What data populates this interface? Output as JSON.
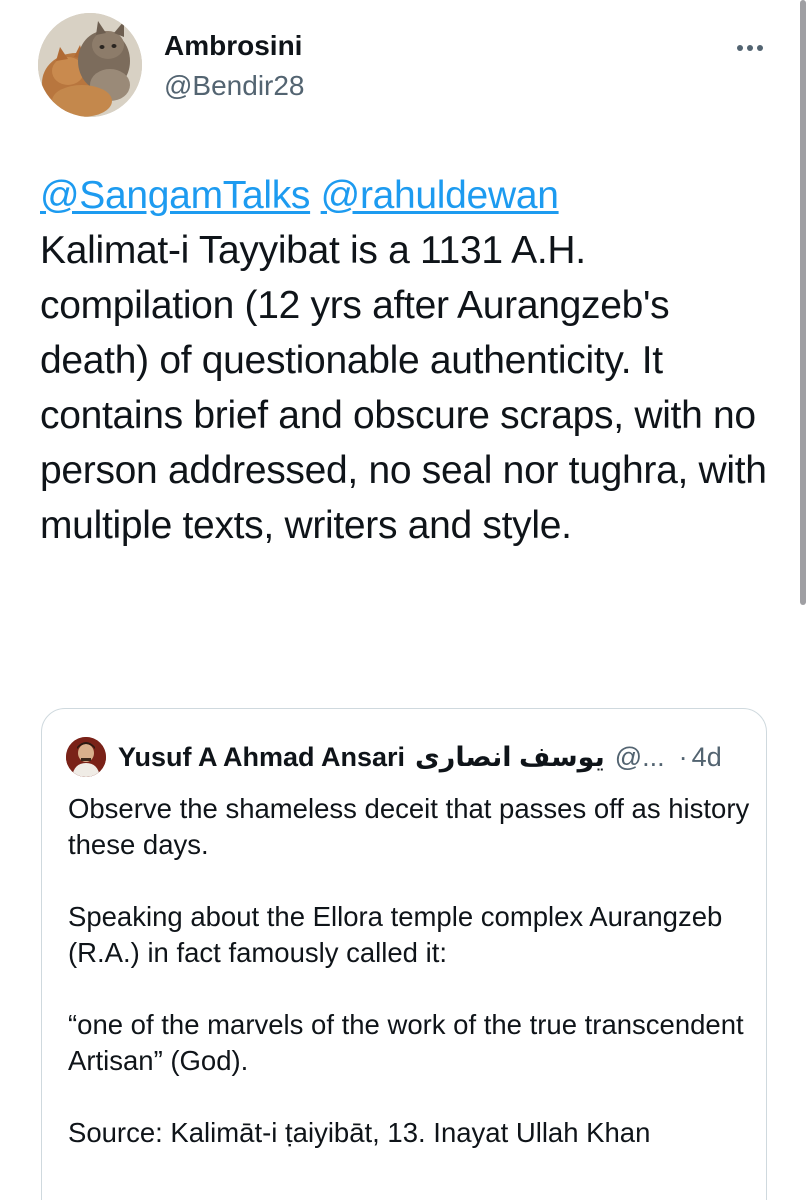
{
  "author": {
    "name": "Ambrosini",
    "handle": "@Bendir28",
    "avatar_icon": "cat-avatar-icon"
  },
  "tweet": {
    "mentions": [
      "@SangamTalks",
      "@rahuldewan"
    ],
    "text": "Kalimat-i Tayyibat is a 1131 A.H. compilation (12 yrs after Aurangzeb's death) of questionable authenticity. It contains brief and obscure scraps, with no person addressed, no seal nor tughra, with multiple texts, writers and style."
  },
  "more_icon": "more-horizontal-icon",
  "quote": {
    "name": "Yusuf A Ahmad Ansari",
    "name_urdu": "یوسف انصاری",
    "handle": "@...",
    "separator": "·",
    "time": "4d",
    "paragraphs": [
      "Observe the shameless deceit that passes off as history these days.",
      "Speaking about the Ellora temple complex Aurangzeb (R.A.) in fact famously called it:",
      "“one of the marvels of the work of the true transcendent Artisan” (God).",
      "Source: Kalimāt-i ṭaiyibāt, 13. Inayat Ullah Khan"
    ]
  },
  "colors": {
    "link": "#1d9bf0",
    "text": "#0f1419",
    "secondary": "#536471",
    "border": "#cfd9de"
  }
}
